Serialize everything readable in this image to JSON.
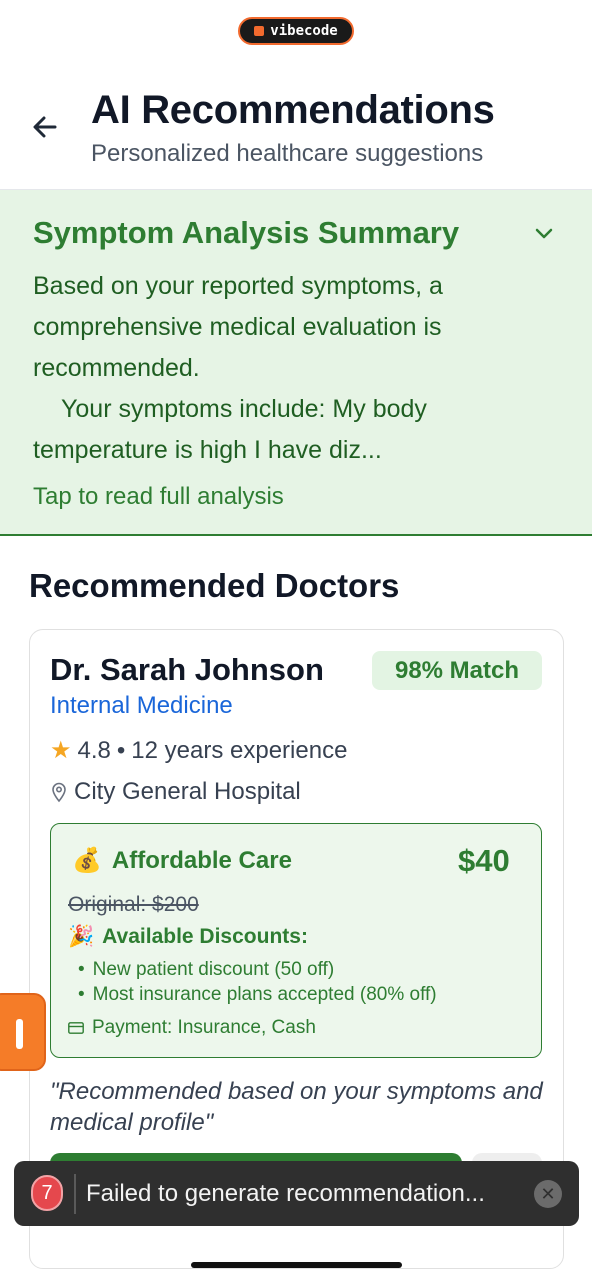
{
  "app_badge": {
    "label": "vibecode"
  },
  "header": {
    "title": "AI Recommendations",
    "subtitle": "Personalized healthcare suggestions",
    "back_icon": "arrow-left-icon"
  },
  "summary": {
    "title": "Symptom Analysis Summary",
    "text_line1": "Based on your reported symptoms, a comprehensive medical evaluation is recommended.",
    "text_line2": "Your symptoms include: My body temperature is high I have diz...",
    "tap_label": "Tap to read full analysis",
    "toggle_icon": "chevron-down-icon",
    "colors": {
      "background": "#e6f4e5",
      "accent": "#2e7d32"
    }
  },
  "doctors_section": {
    "title": "Recommended Doctors",
    "doctors": [
      {
        "name": "Dr. Sarah Johnson",
        "match": "98% Match",
        "specialty": "Internal Medicine",
        "rating": "4.8",
        "separator": "•",
        "experience": "12 years experience",
        "location": "City General Hospital",
        "care": {
          "title": "Affordable Care",
          "title_icon": "💰",
          "price": "$40",
          "original": "Original: $200",
          "discounts_title": "Available Discounts:",
          "discounts_icon": "🎉",
          "discounts": [
            "New patient discount (50 off)",
            "Most insurance plans accepted (80% off)"
          ],
          "payment": "Payment: Insurance, Cash"
        },
        "quote": "\"Recommended based on your symptoms and medical profile\""
      }
    ]
  },
  "toast": {
    "count": "7",
    "message": "Failed to generate recommendation...",
    "close_icon": "close-icon"
  }
}
